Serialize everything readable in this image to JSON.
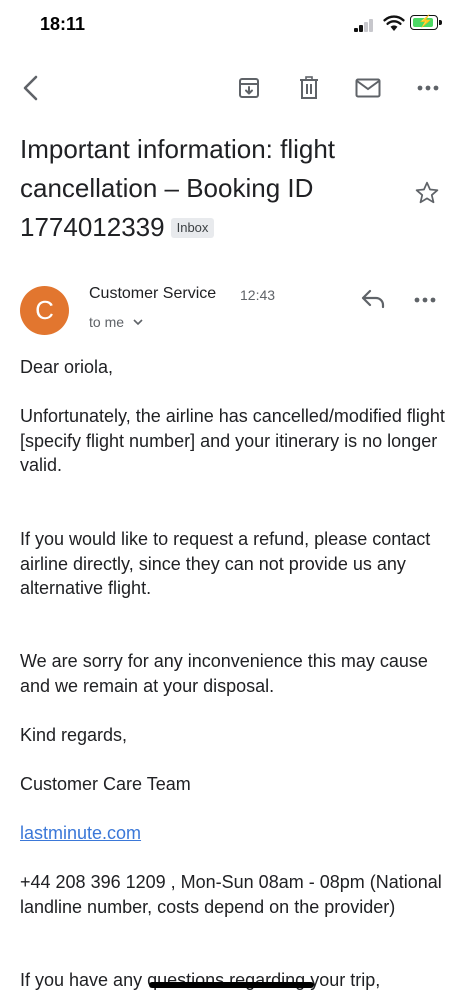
{
  "status_bar": {
    "time": "18:11"
  },
  "email": {
    "subject": "Important information: flight cancellation – Booking ID 1774012339",
    "label": "Inbox",
    "avatar_letter": "C",
    "sender": "Customer Service",
    "time": "12:43",
    "recipient": "to me",
    "body": {
      "greeting": "Dear oriola,",
      "para1": "Unfortunately, the airline has cancelled/modified flight [specify flight number] and your itinerary is no longer valid.",
      "para2": "If you would like to request a refund, please contact airline directly, since they can not provide us any alternative flight.",
      "para3": "We are sorry for any inconvenience this may cause and we remain at your disposal.",
      "closing": "Kind regards,",
      "signature": "Customer Care Team",
      "link": "lastminute.com",
      "phone": "+44 208 396 1209 , Mon-Sun 08am - 08pm (National landline number, costs depend on the provider)",
      "para4": "If you have any questions regarding your trip,"
    }
  },
  "icons": [
    "back-arrow-icon",
    "archive-icon",
    "trash-icon",
    "mail-icon",
    "more-icon",
    "star-icon",
    "reply-icon",
    "chevron-down-icon"
  ],
  "colors": {
    "avatar": "#e2762f",
    "link": "#3b78d8",
    "badge_bg": "#e8eaed",
    "battery": "#4cd964"
  }
}
